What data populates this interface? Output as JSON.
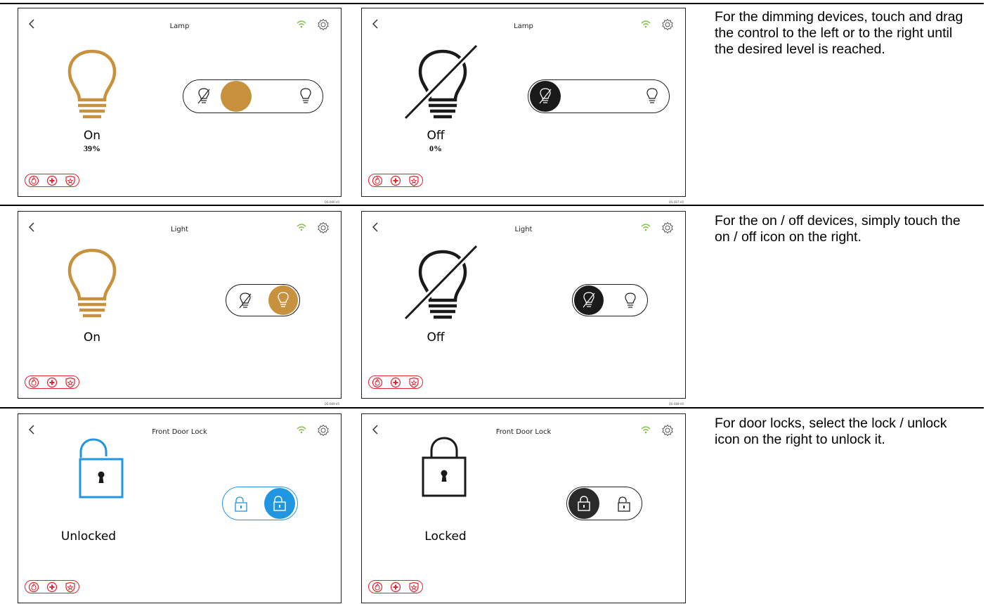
{
  "colors": {
    "amber": "#c8913d",
    "blue": "#2196e0",
    "alarm": "#e0252f",
    "wifi": "#7cc23f",
    "dark": "#1a1a1a"
  },
  "rows": [
    {
      "description": "For the dimming devices, touch and drag the control to the left or to the right until the desired level is reached.",
      "panels": [
        {
          "title": "Lamp",
          "state": "On",
          "level": "39%",
          "code": "QS-086-V0"
        },
        {
          "title": "Lamp",
          "state": "Off",
          "level": "0%",
          "code": "QS-087-V0"
        }
      ]
    },
    {
      "description": "For the on / off devices, simply touch the on / off icon on the right.",
      "panels": [
        {
          "title": "Light",
          "state": "On",
          "code": "QS-089-V0"
        },
        {
          "title": "Light",
          "state": "Off",
          "code": "QS-088-V0"
        }
      ]
    },
    {
      "description": "For door locks, select the lock / unlock icon on the right to unlock it.",
      "panels": [
        {
          "title": "Front Door Lock",
          "state": "Unlocked"
        },
        {
          "title": "Front Door Lock",
          "state": "Locked"
        }
      ]
    }
  ],
  "icons": {
    "back": "chevron-left-icon",
    "wifi": "wifi-icon",
    "settings": "gear-icon",
    "fire": "fire-icon",
    "medical": "medical-cross-icon",
    "police": "police-badge-icon"
  }
}
